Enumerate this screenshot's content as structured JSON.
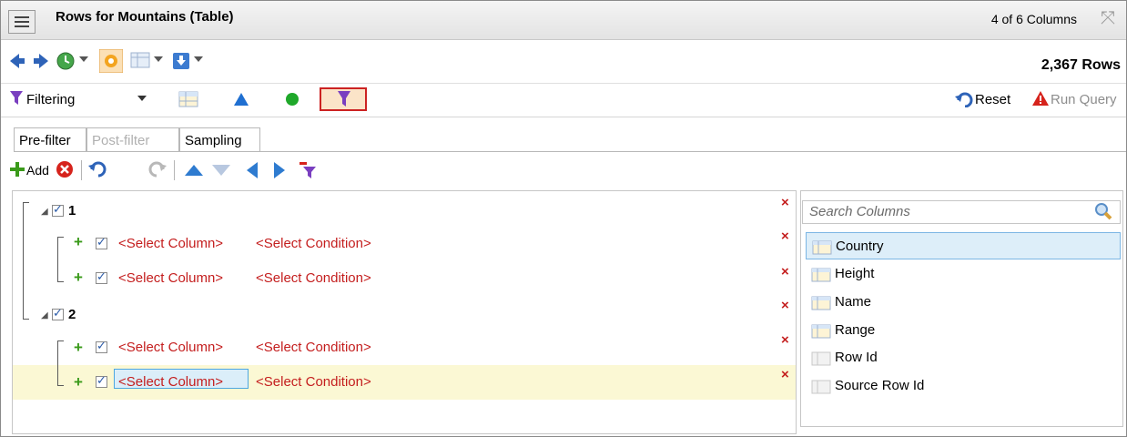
{
  "window": {
    "title": "Rows for Mountains (Table)",
    "column_count": "4 of 6 Columns"
  },
  "navbar": {
    "row_count": "2,367 Rows"
  },
  "filterbar": {
    "mode": "Filtering",
    "reset_label": "Reset",
    "run_query_label": "Run Query"
  },
  "tabs": [
    {
      "label": "Pre-filter",
      "active": true
    },
    {
      "label": "Post-filter",
      "disabled": true
    },
    {
      "label": "Sampling"
    }
  ],
  "toolbar": {
    "add_label": "Add"
  },
  "tree": {
    "groups": [
      {
        "label": "1",
        "conditions": [
          {
            "column": "<Select Column>",
            "condition": "<Select Condition>"
          },
          {
            "column": "<Select Column>",
            "condition": "<Select Condition>"
          }
        ]
      },
      {
        "label": "2",
        "conditions": [
          {
            "column": "<Select Column>",
            "condition": "<Select Condition>"
          },
          {
            "column": "<Select Column>",
            "condition": "<Select Condition>",
            "selected": true
          }
        ]
      }
    ]
  },
  "columns_panel": {
    "search_placeholder": "Search Columns",
    "items": [
      {
        "label": "Country",
        "selected": true
      },
      {
        "label": "Height"
      },
      {
        "label": "Name"
      },
      {
        "label": "Range"
      },
      {
        "label": "Row Id"
      },
      {
        "label": "Source Row Id"
      }
    ]
  },
  "colors": {
    "accent_red": "#c41e1e",
    "selection_blue": "#ddeef9",
    "highlight_row": "#fbf8d4",
    "add_green": "#3a9a1a"
  }
}
